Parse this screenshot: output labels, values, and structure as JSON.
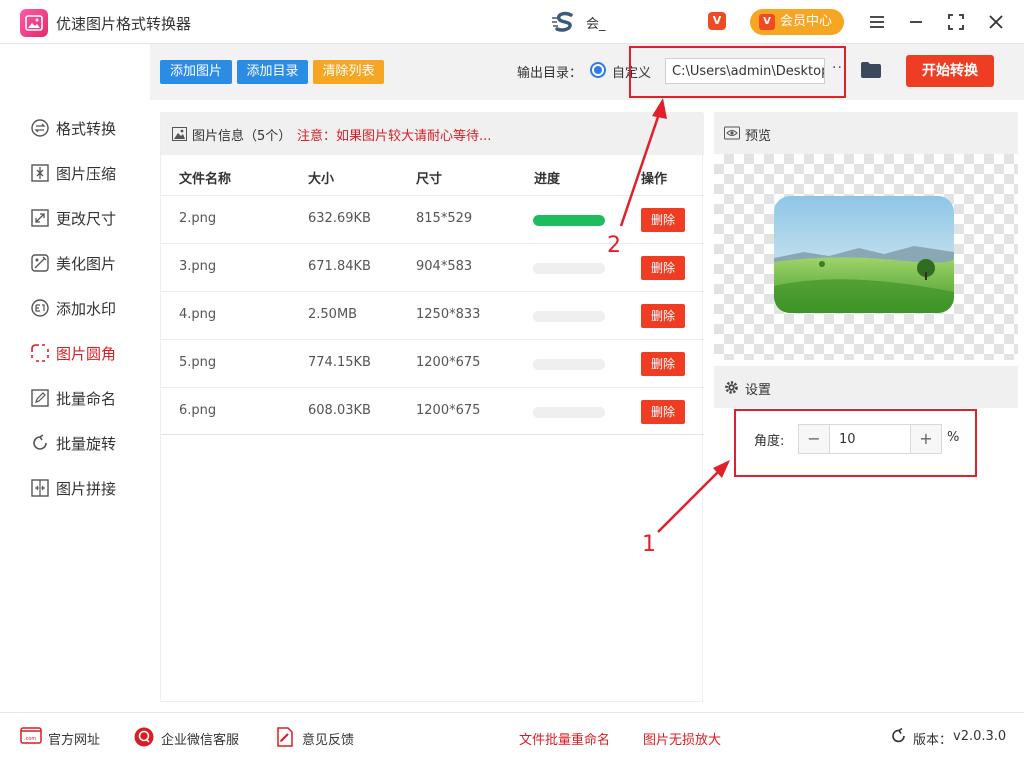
{
  "app": {
    "title": "优速图片格式转换器",
    "user_name": "会_",
    "v_badge": "V",
    "vip_label": "会员中心",
    "vip_badge": "V"
  },
  "sidebar": {
    "items": [
      {
        "label": "格式转换",
        "icon": "format-convert-icon"
      },
      {
        "label": "图片压缩",
        "icon": "compress-icon"
      },
      {
        "label": "更改尺寸",
        "icon": "resize-icon"
      },
      {
        "label": "美化图片",
        "icon": "beautify-icon"
      },
      {
        "label": "添加水印",
        "icon": "watermark-icon"
      },
      {
        "label": "图片圆角",
        "icon": "round-corner-icon",
        "active": true
      },
      {
        "label": "批量命名",
        "icon": "rename-icon"
      },
      {
        "label": "批量旋转",
        "icon": "rotate-icon"
      },
      {
        "label": "图片拼接",
        "icon": "stitch-icon"
      }
    ]
  },
  "toolbar": {
    "add_images": "添加图片",
    "add_folder": "添加目录",
    "clear_list": "清除列表",
    "output_label": "输出目录：",
    "custom_option": "自定义",
    "output_path": "C:\\Users\\admin\\Desktop",
    "more": "···",
    "start": "开始转换"
  },
  "file_list": {
    "info_label": "图片信息（5个）",
    "notice": "注意：如果图片较大请耐心等待...",
    "columns": [
      "文件名称",
      "大小",
      "尺寸",
      "进度",
      "操作"
    ],
    "delete_label": "删除",
    "rows": [
      {
        "name": "2.png",
        "size": "632.69KB",
        "dims": "815*529",
        "progress": 1.0
      },
      {
        "name": "3.png",
        "size": "671.84KB",
        "dims": "904*583",
        "progress": 0
      },
      {
        "name": "4.png",
        "size": "2.50MB",
        "dims": "1250*833",
        "progress": 0
      },
      {
        "name": "5.png",
        "size": "774.15KB",
        "dims": "1200*675",
        "progress": 0
      },
      {
        "name": "6.png",
        "size": "608.03KB",
        "dims": "1200*675",
        "progress": 0
      }
    ]
  },
  "preview": {
    "label": "预览"
  },
  "settings": {
    "label": "设置",
    "angle_label": "角度:",
    "angle_value": "10",
    "minus": "−",
    "plus": "+",
    "unit": "%"
  },
  "annotations": {
    "one": "1",
    "two": "2"
  },
  "footer": {
    "website": "官方网址",
    "wechat": "企业微信客服",
    "feedback": "意见反馈",
    "batch_rename": "文件批量重命名",
    "lossless": "图片无损放大",
    "version_label": "版本：",
    "version": "v2.0.3.0"
  },
  "colors": {
    "accent_red": "#ef3d24",
    "active_red": "#d81e24",
    "blue_button": "#2b8ce6",
    "orange_button": "#f5a623",
    "progress_green": "#1fbb5f"
  }
}
